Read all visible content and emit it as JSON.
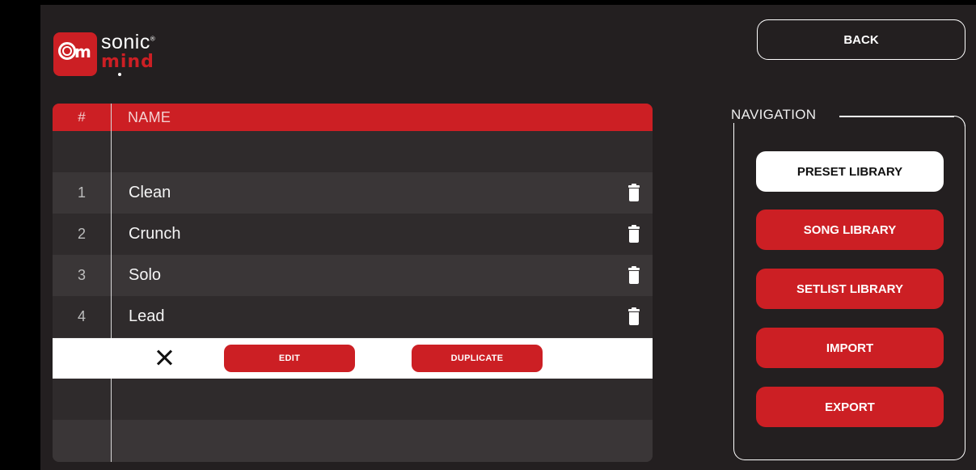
{
  "app": {
    "logo_word_top": "sonic",
    "logo_word_bottom": "mind",
    "logo_registered": "®",
    "logo_badge_letter": "m"
  },
  "header": {
    "back_label": "BACK"
  },
  "table": {
    "col_number": "#",
    "col_name": "NAME",
    "rows": [
      {
        "num": "1",
        "name": "Clean"
      },
      {
        "num": "2",
        "name": "Crunch"
      },
      {
        "num": "3",
        "name": "Solo"
      },
      {
        "num": "4",
        "name": "Lead"
      }
    ],
    "actions": {
      "edit_label": "EDIT",
      "duplicate_label": "DUPLICATE"
    }
  },
  "navigation": {
    "title": "NAVIGATION",
    "items": [
      {
        "label": "PRESET LIBRARY",
        "active": true
      },
      {
        "label": "SONG LIBRARY",
        "active": false
      },
      {
        "label": "SETLIST LIBRARY",
        "active": false
      },
      {
        "label": "IMPORT",
        "active": false
      },
      {
        "label": "EXPORT",
        "active": false
      }
    ]
  },
  "colors": {
    "accent": "#cc1f24",
    "background": "#231f20",
    "row_light": "#3a3637",
    "row_dark": "#2f2b2c"
  },
  "icons": {
    "delete": "trash-icon",
    "close": "close-icon"
  }
}
